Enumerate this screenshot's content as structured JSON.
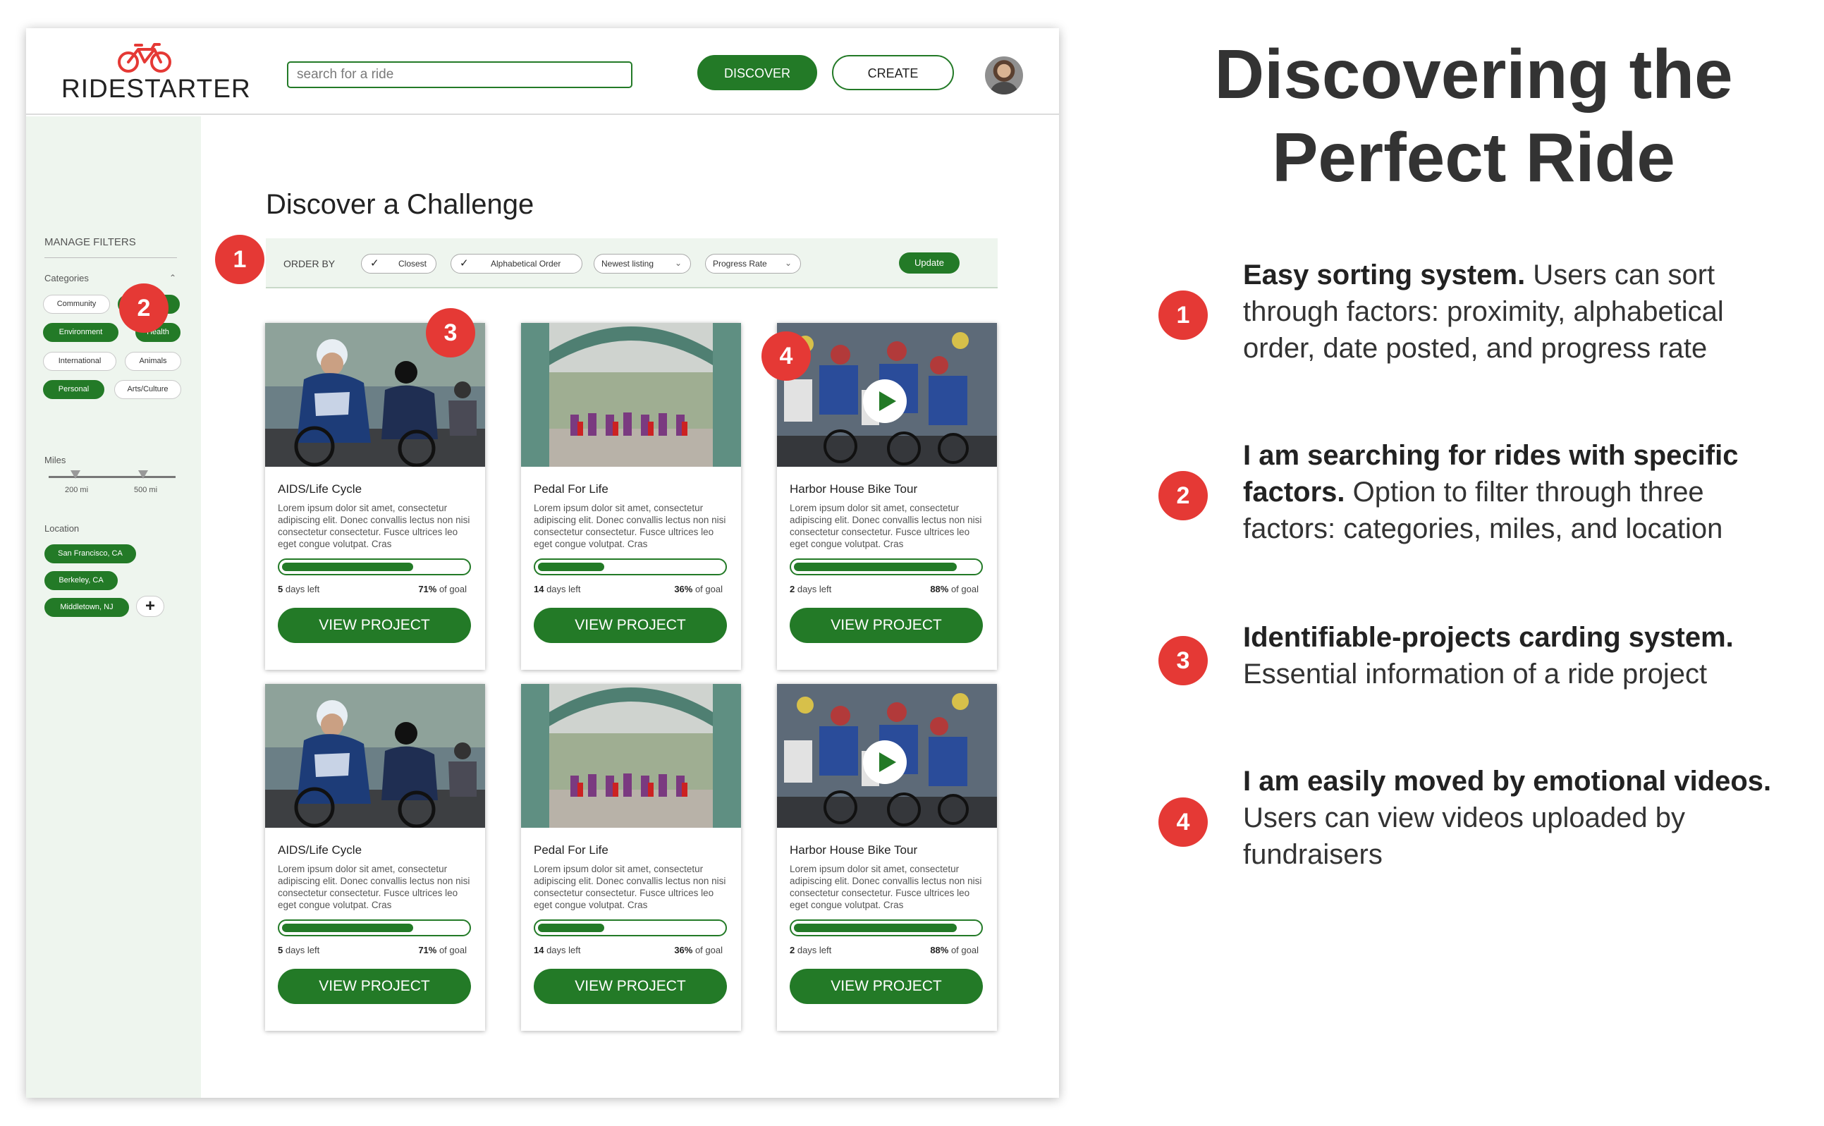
{
  "header": {
    "logo_text": "RIDESTARTER",
    "search_placeholder": "search for a ride",
    "discover_label": "DISCOVER",
    "create_label": "CREATE"
  },
  "sidebar": {
    "manage_filters": "MANAGE FILTERS",
    "categories_label": "Categories",
    "categories": [
      {
        "label": "Community",
        "selected": false
      },
      {
        "label": "Education",
        "selected": true
      },
      {
        "label": "Environment",
        "selected": true
      },
      {
        "label": "Health",
        "selected": true
      },
      {
        "label": "International",
        "selected": false
      },
      {
        "label": "Animals",
        "selected": false
      },
      {
        "label": "Personal",
        "selected": true
      },
      {
        "label": "Arts/Culture",
        "selected": false
      }
    ],
    "miles_label": "Miles",
    "miles_min": "200 mi",
    "miles_max": "500 mi",
    "location_label": "Location",
    "locations": [
      "San Francisco, CA",
      "Berkeley, CA",
      "Middletown, NJ"
    ],
    "add_location": "+"
  },
  "main": {
    "title": "Discover a Challenge",
    "order_by_label": "ORDER BY",
    "order_options": [
      {
        "label": "Closest",
        "type": "check"
      },
      {
        "label": "Alphabetical Order",
        "type": "check"
      },
      {
        "label": "Newest listing",
        "type": "dropdown"
      },
      {
        "label": "Progress Rate",
        "type": "dropdown"
      }
    ],
    "update_label": "Update",
    "cards": [
      {
        "title": "AIDS/Life Cycle",
        "desc": "Lorem ipsum dolor sit amet, consectetur adipiscing elit. Donec convallis lectus non nisi consectetur consectetur. Fusce ultrices leo eget congue volutpat. Cras",
        "days_num": "5",
        "days_text": " days left",
        "goal_num": "71%",
        "goal_text": " of goal",
        "progress": 0.71,
        "button": "VIEW PROJECT",
        "image": "cyclists-photo",
        "video": false
      },
      {
        "title": "Pedal For Life",
        "desc": "Lorem ipsum dolor sit amet, consectetur adipiscing elit. Donec convallis lectus non nisi consectetur consectetur. Fusce ultrices leo eget congue volutpat. Cras",
        "days_num": "14",
        "days_text": " days left",
        "goal_num": "36%",
        "goal_text": " of goal",
        "progress": 0.36,
        "button": "VIEW PROJECT",
        "image": "gate-photo",
        "video": false
      },
      {
        "title": "Harbor House Bike Tour",
        "desc": "Lorem ipsum dolor sit amet, consectetur adipiscing elit. Donec convallis lectus non nisi consectetur consectetur. Fusce ultrices leo eget congue volutpat. Cras",
        "days_num": "2",
        "days_text": " days left",
        "goal_num": "88%",
        "goal_text": " of goal",
        "progress": 0.88,
        "button": "VIEW PROJECT",
        "image": "peloton-video",
        "video": true
      },
      {
        "title": "AIDS/Life Cycle",
        "desc": "Lorem ipsum dolor sit amet, consectetur adipiscing elit. Donec convallis lectus non nisi consectetur consectetur. Fusce ultrices leo eget congue volutpat. Cras",
        "days_num": "5",
        "days_text": " days left",
        "goal_num": "71%",
        "goal_text": " of goal",
        "progress": 0.71,
        "button": "VIEW PROJECT",
        "image": "cyclists-photo",
        "video": false
      },
      {
        "title": "Pedal For Life",
        "desc": "Lorem ipsum dolor sit amet, consectetur adipiscing elit. Donec convallis lectus non nisi consectetur consectetur. Fusce ultrices leo eget congue volutpat. Cras",
        "days_num": "14",
        "days_text": " days left",
        "goal_num": "36%",
        "goal_text": " of goal",
        "progress": 0.36,
        "button": "VIEW PROJECT",
        "image": "gate-photo",
        "video": false
      },
      {
        "title": "Harbor House Bike Tour",
        "desc": "Lorem ipsum dolor sit amet, consectetur adipiscing elit. Donec convallis lectus non nisi consectetur consectetur. Fusce ultrices leo eget congue volutpat. Cras",
        "days_num": "2",
        "days_text": " days left",
        "goal_num": "88%",
        "goal_text": " of goal",
        "progress": 0.88,
        "button": "VIEW PROJECT",
        "image": "peloton-video",
        "video": true
      }
    ]
  },
  "badges": [
    "1",
    "2",
    "3",
    "4"
  ],
  "annotations": {
    "heading_line1": "Discovering the",
    "heading_line2": "Perfect Ride",
    "items": [
      {
        "num": "1",
        "bold": "Easy sorting system.",
        "text": " Users can sort through factors: proximity, alphabetical order, date posted, and progress rate"
      },
      {
        "num": "2",
        "bold": "I am searching for rides with specific factors.",
        "text": " Option to filter through three factors: categories, miles, and location"
      },
      {
        "num": "3",
        "bold": "Identifiable-projects carding system.",
        "text": " Essential information of a ride project"
      },
      {
        "num": "4",
        "bold": "I am easily moved by emotional videos.",
        "text": " Users can view videos uploaded by fundraisers"
      }
    ]
  },
  "colors": {
    "brand_green": "#237a27",
    "badge_red": "#e53935",
    "sidebar_bg": "#eef5ee"
  }
}
